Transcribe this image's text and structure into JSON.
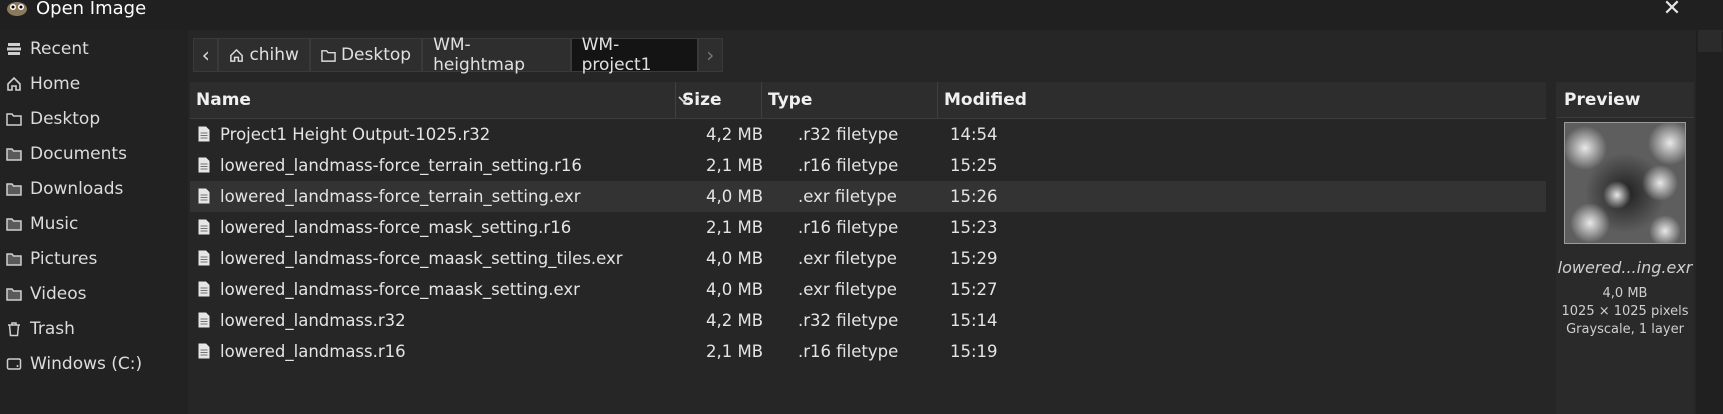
{
  "window": {
    "title": "Open Image",
    "close_glyph": "✕",
    "icon": "gimp-wilber-icon"
  },
  "sidebar": {
    "items": [
      {
        "label": "Recent",
        "icon": "recent-icon"
      },
      {
        "label": "Home",
        "icon": "home-icon"
      },
      {
        "label": "Desktop",
        "icon": "folder-icon"
      },
      {
        "label": "Documents",
        "icon": "folder-icon"
      },
      {
        "label": "Downloads",
        "icon": "folder-icon"
      },
      {
        "label": "Music",
        "icon": "folder-icon"
      },
      {
        "label": "Pictures",
        "icon": "folder-icon"
      },
      {
        "label": "Videos",
        "icon": "folder-icon"
      },
      {
        "label": "Trash",
        "icon": "trash-icon"
      },
      {
        "label": "Windows (C:)",
        "icon": "drive-icon"
      }
    ]
  },
  "pathbar": {
    "back_glyph": "‹",
    "forward_glyph": "›",
    "crumbs": [
      "chihw",
      "Desktop",
      "WM-heightmap",
      "WM-project1"
    ]
  },
  "columns": {
    "name": "Name",
    "size": "Size",
    "type": "Type",
    "modified": "Modified"
  },
  "files": [
    {
      "name": "Project1 Height Output-1025.r32",
      "size": "4,2 MB",
      "type": ".r32 filetype",
      "modified": "14:54"
    },
    {
      "name": "lowered_landmass-force_terrain_setting.r16",
      "size": "2,1 MB",
      "type": ".r16 filetype",
      "modified": "15:25"
    },
    {
      "name": "lowered_landmass-force_terrain_setting.exr",
      "size": "4,0 MB",
      "type": ".exr filetype",
      "modified": "15:26"
    },
    {
      "name": "lowered_landmass-force_mask_setting.r16",
      "size": "2,1 MB",
      "type": ".r16 filetype",
      "modified": "15:23"
    },
    {
      "name": "lowered_landmass-force_maask_setting_tiles.exr",
      "size": "4,0 MB",
      "type": ".exr filetype",
      "modified": "15:29"
    },
    {
      "name": "lowered_landmass-force_maask_setting.exr",
      "size": "4,0 MB",
      "type": ".exr filetype",
      "modified": "15:27"
    },
    {
      "name": "lowered_landmass.r32",
      "size": "4,2 MB",
      "type": ".r32 filetype",
      "modified": "15:14"
    },
    {
      "name": "lowered_landmass.r16",
      "size": "2,1 MB",
      "type": ".r16 filetype",
      "modified": "15:19"
    }
  ],
  "selected_index": 2,
  "preview": {
    "header": "Preview",
    "name": "lowered...ing.exr",
    "size": "4,0 MB",
    "dimensions": "1025 × 1025 pixels",
    "mode": "Grayscale, 1 layer"
  },
  "colors": {
    "background": "#1f1f1f",
    "selected_row": "#333333",
    "header": "#2d2d2d"
  }
}
